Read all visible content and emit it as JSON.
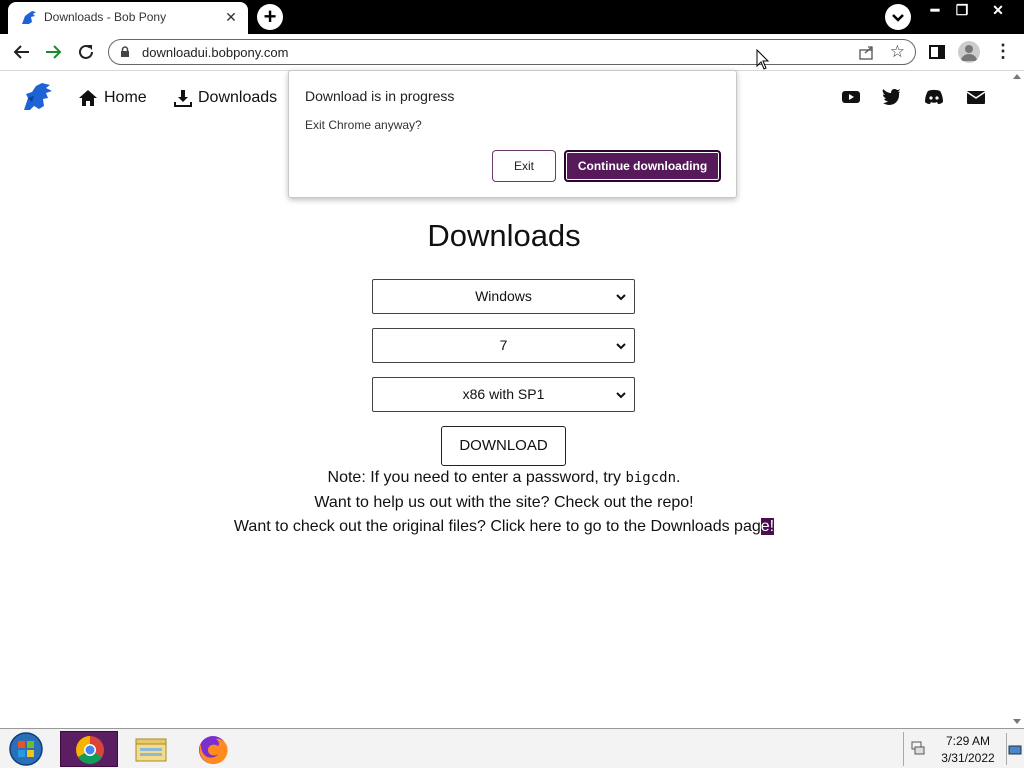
{
  "browser": {
    "tab": {
      "title": "Downloads - Bob Pony",
      "close_glyph": "✕"
    },
    "new_tab_glyph": "+",
    "window_buttons": {
      "minimize": "━",
      "restore": "❐",
      "close": "✕"
    },
    "address_bar": {
      "url": "downloadui.bobpony.com"
    },
    "menu_glyph": "⋮",
    "star_glyph": "☆"
  },
  "site_nav": {
    "links": [
      {
        "label": "Home"
      },
      {
        "label": "Downloads"
      }
    ],
    "social_icons": [
      "youtube-icon",
      "twitter-icon",
      "discord-icon",
      "email-icon"
    ]
  },
  "main": {
    "heading": "Downloads",
    "selects": [
      {
        "value": "Windows"
      },
      {
        "value": "7"
      },
      {
        "value": "x86 with SP1"
      }
    ],
    "download_button": "DOWNLOAD",
    "note_prefix": "Note: If you need to enter a password, try ",
    "note_code": "bigcdn",
    "note_suffix": ".",
    "repo_line": "Want to help us out with the site? Check out the repo!",
    "original_line_main": "Want to check out the original files? Click here to go to the Downloads pag",
    "original_line_selected": "e!"
  },
  "dialog": {
    "title": "Download is in progress",
    "message": "Exit Chrome anyway?",
    "exit_button": "Exit",
    "continue_button": "Continue downloading"
  },
  "taskbar": {
    "clock_time": "7:29 AM",
    "clock_date": "3/31/2022"
  },
  "colors": {
    "accent_purple": "#561a5b",
    "selection_purple": "#4a0e4e",
    "tabstrip": "#000000"
  }
}
